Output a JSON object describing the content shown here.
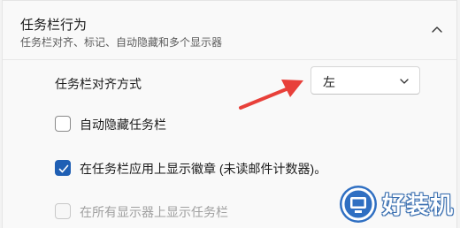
{
  "section": {
    "title": "任务栏行为",
    "subtitle": "任务栏对齐、标记、自动隐藏和多个显示器",
    "collapse_icon": "chevron-up-icon"
  },
  "alignment": {
    "label": "任务栏对齐方式",
    "selected": "左",
    "chevron_icon": "chevron-down-icon"
  },
  "options": [
    {
      "label": "自动隐藏任务栏",
      "checked": false,
      "enabled": true
    },
    {
      "label": "在任务栏应用上显示徽章 (未读邮件计数器)。",
      "checked": true,
      "enabled": true
    },
    {
      "label": "在所有显示器上显示任务栏",
      "checked": false,
      "enabled": false
    }
  ],
  "annotation": {
    "arrow_color": "#e8403a"
  },
  "watermark": {
    "text": "好装机"
  },
  "colors": {
    "accent": "#1f5fb4",
    "background": "#f9f9f9"
  }
}
